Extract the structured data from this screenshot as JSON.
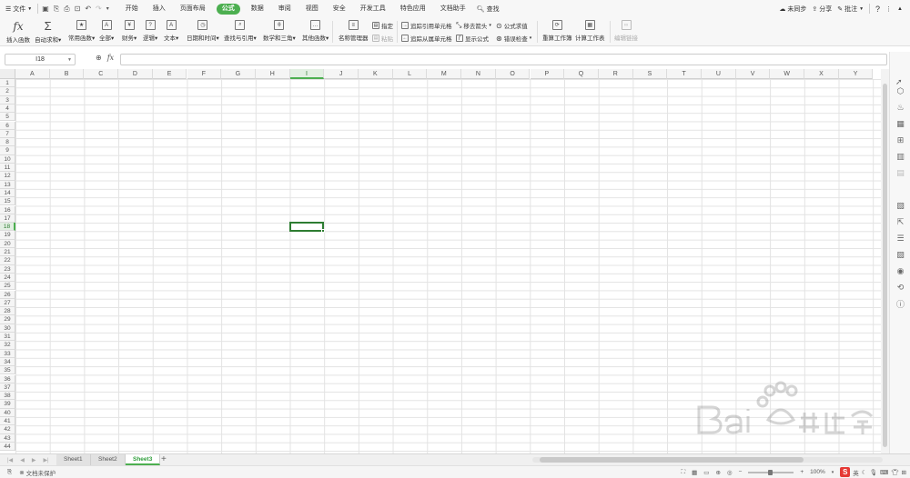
{
  "menubar": {
    "file_label": "文件",
    "tabs": [
      {
        "label": "开始",
        "active": false
      },
      {
        "label": "插入",
        "active": false
      },
      {
        "label": "页面布局",
        "active": false
      },
      {
        "label": "公式",
        "active": true
      },
      {
        "label": "数据",
        "active": false
      },
      {
        "label": "审阅",
        "active": false
      },
      {
        "label": "视图",
        "active": false
      },
      {
        "label": "安全",
        "active": false
      },
      {
        "label": "开发工具",
        "active": false
      },
      {
        "label": "特色应用",
        "active": false
      },
      {
        "label": "文档助手",
        "active": false
      }
    ],
    "search_label": "查找",
    "sync_label": "未同步",
    "share_label": "分享",
    "comment_label": "批注",
    "help_label": "?"
  },
  "ribbon": {
    "insert_function": "插入函数",
    "autosum": "自动求和",
    "common_functions": "常用函数",
    "all": "全部",
    "financial": "财务",
    "logical": "逻辑",
    "text": "文本",
    "datetime": "日期和时间",
    "lookup": "查找与引用",
    "math": "数学和三角",
    "other": "其他函数",
    "name_manager": "名称管理器",
    "specify": "指定",
    "paste": "粘贴",
    "trace_precedents": "追踪引用单元格",
    "trace_dependents": "追踪从属单元格",
    "remove_arrows": "移去箭头",
    "show_formulas": "显示公式",
    "evaluate_formula": "公式求值",
    "error_checking": "错误检查",
    "recalc_workbook": "重算工作簿",
    "calc_sheet": "计算工作表",
    "edit_link": "编辑链接",
    "fx_symbol": "fx",
    "sum_symbol": "Σ"
  },
  "formula_bar": {
    "name_box": "I18",
    "fx_label": "fx",
    "value": ""
  },
  "grid": {
    "columns": [
      "A",
      "B",
      "C",
      "D",
      "E",
      "F",
      "G",
      "H",
      "I",
      "J",
      "K",
      "L",
      "M",
      "N",
      "O",
      "P",
      "Q",
      "R",
      "S",
      "T",
      "U",
      "V",
      "W",
      "X",
      "Y"
    ],
    "rows": [
      "1",
      "2",
      "3",
      "4",
      "5",
      "6",
      "7",
      "8",
      "9",
      "10",
      "11",
      "12",
      "13",
      "14",
      "15",
      "16",
      "17",
      "18",
      "19",
      "20",
      "21",
      "22",
      "23",
      "24",
      "25",
      "26",
      "27",
      "28",
      "29",
      "30",
      "31",
      "32",
      "33",
      "34",
      "35",
      "36",
      "37",
      "38",
      "39",
      "40",
      "41",
      "42",
      "43",
      "44"
    ],
    "selected_column": "I",
    "selected_row": "18"
  },
  "sheets": [
    {
      "label": "Sheet1",
      "active": false
    },
    {
      "label": "Sheet2",
      "active": false
    },
    {
      "label": "Sheet3",
      "active": true
    }
  ],
  "status": {
    "protection": "文档未保护",
    "zoom": "100%",
    "ime_label": "英"
  },
  "colors": {
    "accent": "#4caf50",
    "selection": "#2e7d32"
  }
}
